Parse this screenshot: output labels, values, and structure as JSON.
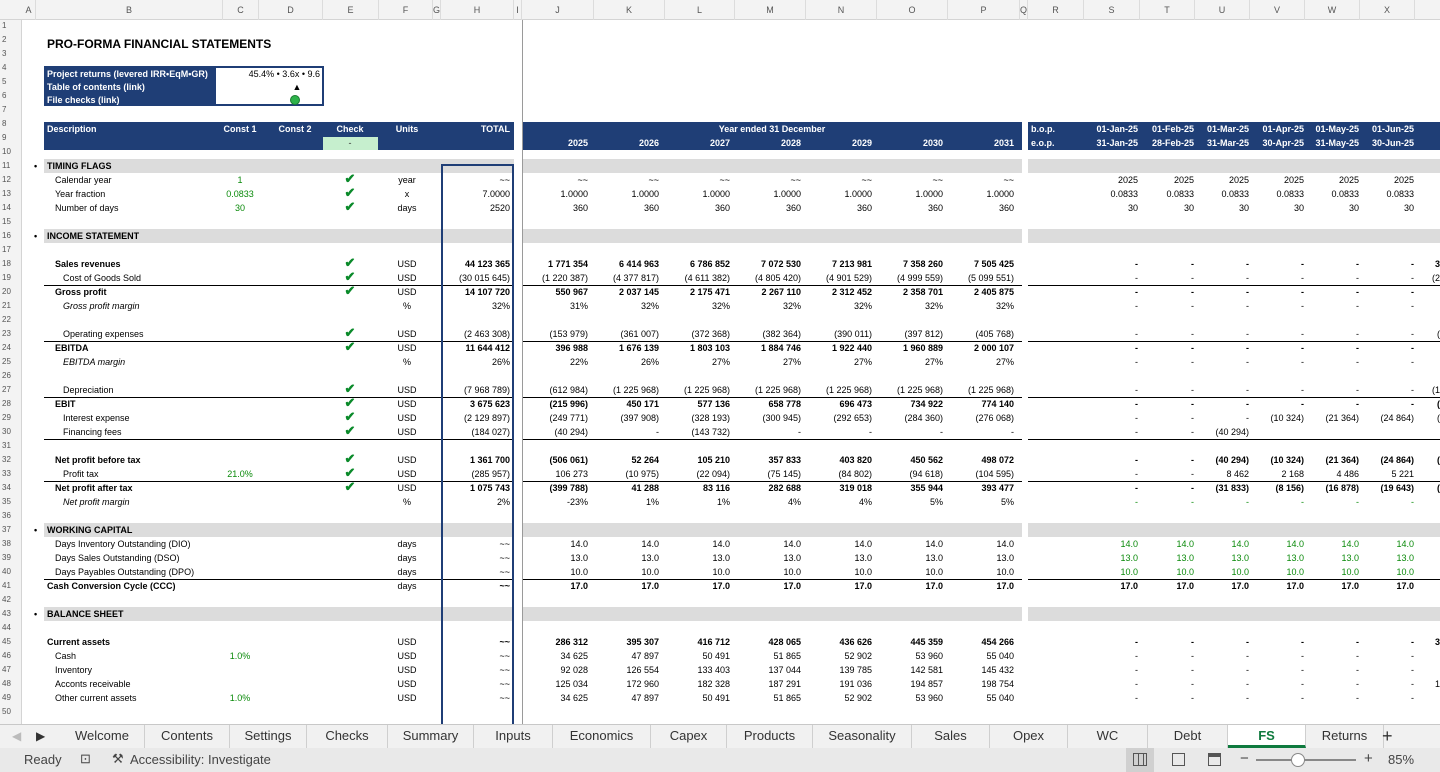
{
  "columns": [
    "A",
    "B",
    "C",
    "D",
    "E",
    "F",
    "G",
    "H",
    "I",
    "J",
    "K",
    "L",
    "M",
    "N",
    "O",
    "P",
    "Q",
    "R",
    "S",
    "T",
    "U",
    "V",
    "W",
    "X"
  ],
  "title": "PRO-FORMA FINANCIAL STATEMENTS",
  "summary": {
    "row1_label": "Project returns (levered IRR•EqM•GR)",
    "row1_value": "45.4% • 3.6x • 9.6",
    "row2_label": "Table of contents (link)",
    "row2_value": "▲",
    "row3_label": "File checks (link)"
  },
  "header": {
    "description": "Description",
    "const1": "Const 1",
    "const2": "Const 2",
    "check": "Check",
    "units": "Units",
    "check_value": "-",
    "total": "TOTAL",
    "year_ended": "Year ended 31 December",
    "years": [
      "2025",
      "2026",
      "2027",
      "2028",
      "2029",
      "2030",
      "2031"
    ],
    "bop": "b.o.p.",
    "eop": "e.o.p.",
    "bop_dates": [
      "01-Jan-25",
      "01-Feb-25",
      "01-Mar-25",
      "01-Apr-25",
      "01-May-25",
      "01-Jun-25",
      "01"
    ],
    "eop_dates": [
      "31-Jan-25",
      "28-Feb-25",
      "31-Mar-25",
      "30-Apr-25",
      "31-May-25",
      "30-Jun-25",
      "31"
    ]
  },
  "sections": {
    "timing": "TIMING FLAGS",
    "income": "INCOME STATEMENT",
    "wc": "WORKING CAPITAL",
    "bs": "BALANCE SHEET"
  },
  "rows": [
    {
      "r": 12,
      "label": "Calendar year",
      "c1": "1",
      "c1g": true,
      "chk": true,
      "unit": "year",
      "total": "~~",
      "vals": [
        "~~",
        "~~",
        "~~",
        "~~",
        "~~",
        "~~",
        "~~"
      ],
      "m": [
        "2025",
        "2025",
        "2025",
        "2025",
        "2025",
        "2025"
      ]
    },
    {
      "r": 13,
      "label": "Year fraction",
      "c1": "0.0833",
      "c1g": true,
      "chk": true,
      "unit": "x",
      "total": "7.0000",
      "vals": [
        "1.0000",
        "1.0000",
        "1.0000",
        "1.0000",
        "1.0000",
        "1.0000",
        "1.0000"
      ],
      "m": [
        "0.0833",
        "0.0833",
        "0.0833",
        "0.0833",
        "0.0833",
        "0.0833"
      ]
    },
    {
      "r": 14,
      "label": "Number of days",
      "c1": "30",
      "c1g": true,
      "chk": true,
      "unit": "days",
      "total": "2520",
      "vals": [
        "360",
        "360",
        "360",
        "360",
        "360",
        "360",
        "360"
      ],
      "m": [
        "30",
        "30",
        "30",
        "30",
        "30",
        "30"
      ]
    },
    {
      "r": 18,
      "label": "Sales revenues",
      "bold": true,
      "chk": true,
      "unit": "USD",
      "total": "44 123 365",
      "vals": [
        "1 771 354",
        "6 414 963",
        "6 786 852",
        "7 072 530",
        "7 213 981",
        "7 358 260",
        "7 505 425"
      ],
      "m": [
        "-",
        "-",
        "-",
        "-",
        "-",
        "-"
      ],
      "last": "30"
    },
    {
      "r": 19,
      "label": "Cost of Goods Sold",
      "ind": 2,
      "chk": true,
      "unit": "USD",
      "total": "(30 015 645)",
      "vals": [
        "(1 220 387)",
        "(4 377 817)",
        "(4 611 382)",
        "(4 805 420)",
        "(4 901 529)",
        "(4 999 559)",
        "(5 099 551)"
      ],
      "m": [
        "-",
        "-",
        "-",
        "-",
        "-",
        "-"
      ],
      "last": "(21",
      "ul": true
    },
    {
      "r": 20,
      "label": "Gross profit",
      "bold": true,
      "chk": true,
      "unit": "USD",
      "total": "14 107 720",
      "vals": [
        "550 967",
        "2 037 145",
        "2 175 471",
        "2 267 110",
        "2 312 452",
        "2 358 701",
        "2 405 875"
      ],
      "m": [
        "-",
        "-",
        "-",
        "-",
        "-",
        "-"
      ],
      "last": "9"
    },
    {
      "r": 21,
      "label": "Gross profit margin",
      "ital": true,
      "ind": 2,
      "unit": "%",
      "total": "32%",
      "vals": [
        "31%",
        "32%",
        "32%",
        "32%",
        "32%",
        "32%",
        "32%"
      ],
      "m": [
        "-",
        "-",
        "-",
        "-",
        "-",
        "-"
      ],
      "last": "-"
    },
    {
      "r": 23,
      "label": "Operating expenses",
      "ind": 2,
      "chk": true,
      "unit": "USD",
      "total": "(2 463 308)",
      "vals": [
        "(153 979)",
        "(361 007)",
        "(372 368)",
        "(382 364)",
        "(390 011)",
        "(397 812)",
        "(405 768)"
      ],
      "m": [
        "-",
        "-",
        "-",
        "-",
        "-",
        "-"
      ],
      "last": "(2",
      "ul": true
    },
    {
      "r": 24,
      "label": "EBITDA",
      "bold": true,
      "chk": true,
      "unit": "USD",
      "total": "11 644 412",
      "vals": [
        "396 988",
        "1 676 139",
        "1 803 103",
        "1 884 746",
        "1 922 440",
        "1 960 889",
        "2 000 107"
      ],
      "m": [
        "-",
        "-",
        "-",
        "-",
        "-",
        "-"
      ],
      "last": "6"
    },
    {
      "r": 25,
      "label": "EBITDA margin",
      "ital": true,
      "ind": 2,
      "unit": "%",
      "total": "26%",
      "vals": [
        "22%",
        "26%",
        "27%",
        "27%",
        "27%",
        "27%",
        "27%"
      ],
      "m": [
        "-",
        "-",
        "-",
        "-",
        "-",
        "-"
      ],
      "last": "-"
    },
    {
      "r": 27,
      "label": "Depreciation",
      "ind": 2,
      "chk": true,
      "unit": "USD",
      "total": "(7 968 789)",
      "vals": [
        "(612 984)",
        "(1 225 968)",
        "(1 225 968)",
        "(1 225 968)",
        "(1 225 968)",
        "(1 225 968)",
        "(1 225 968)"
      ],
      "m": [
        "-",
        "-",
        "-",
        "-",
        "-",
        "-"
      ],
      "last": "(10",
      "ul": true
    },
    {
      "r": 28,
      "label": "EBIT",
      "bold": true,
      "chk": true,
      "unit": "USD",
      "total": "3 675 623",
      "vals": [
        "(215 996)",
        "450 171",
        "577 136",
        "658 778",
        "696 473",
        "734 922",
        "774 140"
      ],
      "m": [
        "-",
        "-",
        "-",
        "-",
        "-",
        "-"
      ],
      "last": "(5"
    },
    {
      "r": 29,
      "label": "Interest expense",
      "ind": 2,
      "chk": true,
      "unit": "USD",
      "total": "(2 129 897)",
      "vals": [
        "(249 771)",
        "(397 908)",
        "(328 193)",
        "(300 945)",
        "(292 653)",
        "(284 360)",
        "(276 068)"
      ],
      "m": [
        "-",
        "-",
        "-",
        "(10 324)",
        "(21 364)",
        "(24 864)"
      ],
      "last": "(2"
    },
    {
      "r": 30,
      "label": "Financing fees",
      "ind": 2,
      "chk": true,
      "unit": "USD",
      "total": "(184 027)",
      "vals": [
        "(40 294)",
        "-",
        "(143 732)",
        "-",
        "-",
        "-",
        "-"
      ],
      "m": [
        "-",
        "-",
        "(40 294)",
        "",
        "",
        ""
      ],
      "last": "",
      "ul": true
    },
    {
      "r": 32,
      "label": "Net profit before tax",
      "bold": true,
      "chk": true,
      "unit": "USD",
      "total": "1 361 700",
      "vals": [
        "(506 061)",
        "52 264",
        "105 210",
        "357 833",
        "403 820",
        "450 562",
        "498 072"
      ],
      "m": [
        "-",
        "-",
        "(40 294)",
        "(10 324)",
        "(21 364)",
        "(24 864)"
      ],
      "last": "(5"
    },
    {
      "r": 33,
      "label": "Profit tax",
      "ind": 2,
      "c1": "21.0%",
      "c1g": true,
      "chk": true,
      "unit": "USD",
      "total": "(285 957)",
      "vals": [
        "106 273",
        "(10 975)",
        "(22 094)",
        "(75 145)",
        "(84 802)",
        "(94 618)",
        "(104 595)"
      ],
      "m": [
        "-",
        "-",
        "8 462",
        "2 168",
        "4 486",
        "5 221"
      ],
      "last": "1",
      "ul": true
    },
    {
      "r": 34,
      "label": "Net profit after tax",
      "bold": true,
      "chk": true,
      "unit": "USD",
      "total": "1 075 743",
      "vals": [
        "(399 788)",
        "41 288",
        "83 116",
        "282 688",
        "319 018",
        "355 944",
        "393 477"
      ],
      "m": [
        "-",
        "-",
        "(31 833)",
        "(8 156)",
        "(16 878)",
        "(19 643)"
      ],
      "last": "(4"
    },
    {
      "r": 35,
      "label": "Net profit margin",
      "ital": true,
      "ind": 2,
      "unit": "%",
      "total": "2%",
      "vals": [
        "-23%",
        "1%",
        "1%",
        "4%",
        "4%",
        "5%",
        "5%"
      ],
      "m": [
        "-",
        "-",
        "-",
        "-",
        "-",
        "-"
      ],
      "mg": true,
      "last": "-"
    },
    {
      "r": 38,
      "label": "Days Inventory Outstanding (DIO)",
      "unit": "days",
      "total": "~~",
      "vals": [
        "14.0",
        "14.0",
        "14.0",
        "14.0",
        "14.0",
        "14.0",
        "14.0"
      ],
      "m": [
        "14.0",
        "14.0",
        "14.0",
        "14.0",
        "14.0",
        "14.0"
      ],
      "mg": true
    },
    {
      "r": 39,
      "label": "Days Sales Outstanding (DSO)",
      "unit": "days",
      "total": "~~",
      "vals": [
        "13.0",
        "13.0",
        "13.0",
        "13.0",
        "13.0",
        "13.0",
        "13.0"
      ],
      "m": [
        "13.0",
        "13.0",
        "13.0",
        "13.0",
        "13.0",
        "13.0"
      ],
      "mg": true
    },
    {
      "r": 40,
      "label": "Days Payables Outstanding (DPO)",
      "unit": "days",
      "total": "~~",
      "vals": [
        "10.0",
        "10.0",
        "10.0",
        "10.0",
        "10.0",
        "10.0",
        "10.0"
      ],
      "m": [
        "10.0",
        "10.0",
        "10.0",
        "10.0",
        "10.0",
        "10.0"
      ],
      "mg": true,
      "ul": true
    },
    {
      "r": 41,
      "label": "Cash Conversion Cycle (CCC)",
      "bold": true,
      "nind": true,
      "unit": "days",
      "total": "~~",
      "vals": [
        "17.0",
        "17.0",
        "17.0",
        "17.0",
        "17.0",
        "17.0",
        "17.0"
      ],
      "m": [
        "17.0",
        "17.0",
        "17.0",
        "17.0",
        "17.0",
        "17.0"
      ]
    },
    {
      "r": 45,
      "label": "Current assets",
      "bold": true,
      "nind": true,
      "unit": "USD",
      "total": "~~",
      "vals": [
        "286 312",
        "395 307",
        "416 712",
        "428 065",
        "436 626",
        "445 359",
        "454 266"
      ],
      "m": [
        "-",
        "-",
        "-",
        "-",
        "-",
        "-"
      ],
      "last": "30"
    },
    {
      "r": 46,
      "label": "Cash",
      "ind": 1,
      "c1": "1.0%",
      "c1g": true,
      "unit": "USD",
      "total": "~~",
      "vals": [
        "34 625",
        "47 897",
        "50 491",
        "51 865",
        "52 902",
        "53 960",
        "55 040"
      ],
      "m": [
        "-",
        "-",
        "-",
        "-",
        "-",
        "-"
      ],
      "last": "3"
    },
    {
      "r": 47,
      "label": "Inventory",
      "ind": 1,
      "unit": "USD",
      "total": "~~",
      "vals": [
        "92 028",
        "126 554",
        "133 403",
        "137 044",
        "139 785",
        "142 581",
        "145 432"
      ],
      "m": [
        "-",
        "-",
        "-",
        "-",
        "-",
        "-"
      ],
      "last": "9"
    },
    {
      "r": 48,
      "label": "Acconts receivable",
      "ind": 1,
      "unit": "USD",
      "total": "~~",
      "vals": [
        "125 034",
        "172 960",
        "182 328",
        "187 291",
        "191 036",
        "194 857",
        "198 754"
      ],
      "m": [
        "-",
        "-",
        "-",
        "-",
        "-",
        "-"
      ],
      "last": "13"
    },
    {
      "r": 49,
      "label": "Other current assets",
      "ind": 1,
      "c1": "1.0%",
      "c1g": true,
      "unit": "USD",
      "total": "~~",
      "vals": [
        "34 625",
        "47 897",
        "50 491",
        "51 865",
        "52 902",
        "53 960",
        "55 040"
      ],
      "m": [
        "-",
        "-",
        "-",
        "-",
        "-",
        "-"
      ],
      "last": "3"
    }
  ],
  "tabs": [
    "Welcome",
    "Contents",
    "Settings",
    "Checks",
    "Summary",
    "Inputs",
    "Economics",
    "Capex",
    "Products",
    "Seasonality",
    "Sales",
    "Opex",
    "WC",
    "Debt",
    "FS",
    "Returns"
  ],
  "active_tab": "FS",
  "status": {
    "ready": "Ready",
    "accessibility": "Accessibility: Investigate",
    "zoom": "85%"
  },
  "colors": {
    "navy": "#1f3e76",
    "check_green": "#c6efce",
    "active_tab": "#0f7a3e"
  }
}
